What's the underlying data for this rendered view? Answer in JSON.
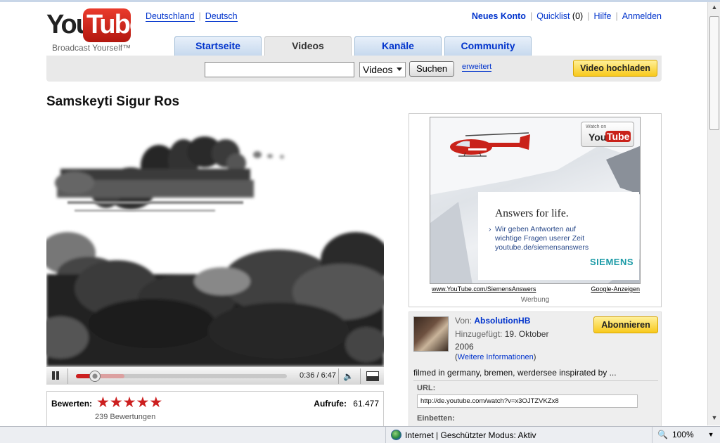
{
  "header": {
    "logo": {
      "you": "You",
      "tube": "Tube",
      "tagline": "Broadcast Yourself™"
    },
    "locale": {
      "country": "Deutschland",
      "language": "Deutsch"
    },
    "user_links": {
      "new_account": "Neues Konto",
      "quicklist": "Quicklist",
      "quicklist_count": "(0)",
      "help": "Hilfe",
      "login": "Anmelden"
    },
    "tabs": [
      {
        "label": "Startseite",
        "active": false
      },
      {
        "label": "Videos",
        "active": true
      },
      {
        "label": "Kanäle",
        "active": false
      },
      {
        "label": "Community",
        "active": false
      }
    ],
    "search": {
      "value": "",
      "select_value": "Videos",
      "button": "Suchen",
      "advanced": "erweitert"
    },
    "upload_button": "Video hochladen"
  },
  "video": {
    "title": "Samskeyti Sigur Ros",
    "time": "0:36 / 6:47",
    "played_fraction": 0.09,
    "buffered_fraction": 0.23,
    "rating_label": "Bewerten:",
    "stars": 5,
    "rating_count": "239 Bewertungen",
    "views_label": "Aufrufe:",
    "views": "61.477"
  },
  "ad": {
    "badge_watch": "Watch on",
    "badge_you": "You",
    "badge_tube": "Tube",
    "headline": "Answers for life.",
    "line1": "Wir geben Antworten auf",
    "line2": "wichtige Fragen userer Zeit",
    "line3": "youtube.de/siemensanswers",
    "brand": "SIEMENS",
    "link_left": "www.YouTube.com/SiemensAnswers",
    "link_right": "Google-Anzeigen",
    "label": "Werbung"
  },
  "uploader": {
    "from_label": "Von:",
    "name": "AbsolutionHB",
    "added_label": "Hinzugefügt:",
    "added_date": "19. Oktober 2006",
    "more_info": "Weitere Informationen",
    "subscribe": "Abonnieren",
    "description": "filmed in germany, bremen, werdersee inspirated by ...",
    "url_label": "URL:",
    "url_value": "http://de.youtube.com/watch?v=x3OJTZVKZx8",
    "embed_label": "Einbetten:"
  },
  "statusbar": {
    "zone": "Internet | Geschützter Modus: Aktiv",
    "zoom": "100%"
  },
  "colors": {
    "tab_link": "#0033cc",
    "yellow_button": "#f8c91c",
    "progress": "#cc1f1f"
  }
}
